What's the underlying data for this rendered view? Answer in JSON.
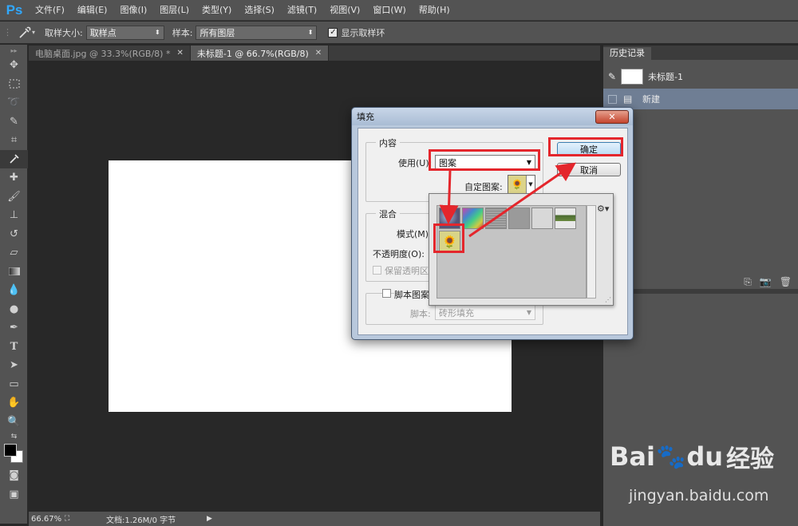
{
  "app": {
    "logo": "Ps"
  },
  "menu": [
    "文件(F)",
    "编辑(E)",
    "图像(I)",
    "图层(L)",
    "类型(Y)",
    "选择(S)",
    "滤镜(T)",
    "视图(V)",
    "窗口(W)",
    "帮助(H)"
  ],
  "options": {
    "sample_size_label": "取样大小:",
    "sample_size_value": "取样点",
    "sample_label": "样本:",
    "sample_value": "所有图层",
    "show_ring_label": "显示取样环",
    "show_ring_checked": true
  },
  "tabs": [
    {
      "label": "电脑桌面.jpg @ 33.3%(RGB/8) *",
      "active": false
    },
    {
      "label": "未标题-1 @ 66.7%(RGB/8)",
      "active": true
    }
  ],
  "status": {
    "zoom": "66.67%",
    "doc": "文档:1.26M/0 字节"
  },
  "history_panel": {
    "tab": "历史记录",
    "snapshot": "未标题-1",
    "items": [
      "新建"
    ]
  },
  "fill_dialog": {
    "title": "填充",
    "content_group": "内容",
    "use_label": "使用(U):",
    "use_value": "图案",
    "custom_pattern_label": "自定图案:",
    "ok_label": "确定",
    "cancel_label": "取消",
    "blend_group": "混合",
    "mode_label": "模式(M):",
    "opacity_label": "不透明度(O):",
    "preserve_label": "保留透明区域",
    "script_pattern_label": "脚本图案",
    "script_label": "脚本:",
    "script_value": "砖形填充"
  },
  "colors": {
    "accent": "#31a8ff",
    "highlight": "#e4262c",
    "selected_row": "#6f7e94"
  },
  "watermark": {
    "brand": "Bai",
    "brand2": "du",
    "cn": "经验",
    "url": "jingyan.baidu.com"
  }
}
